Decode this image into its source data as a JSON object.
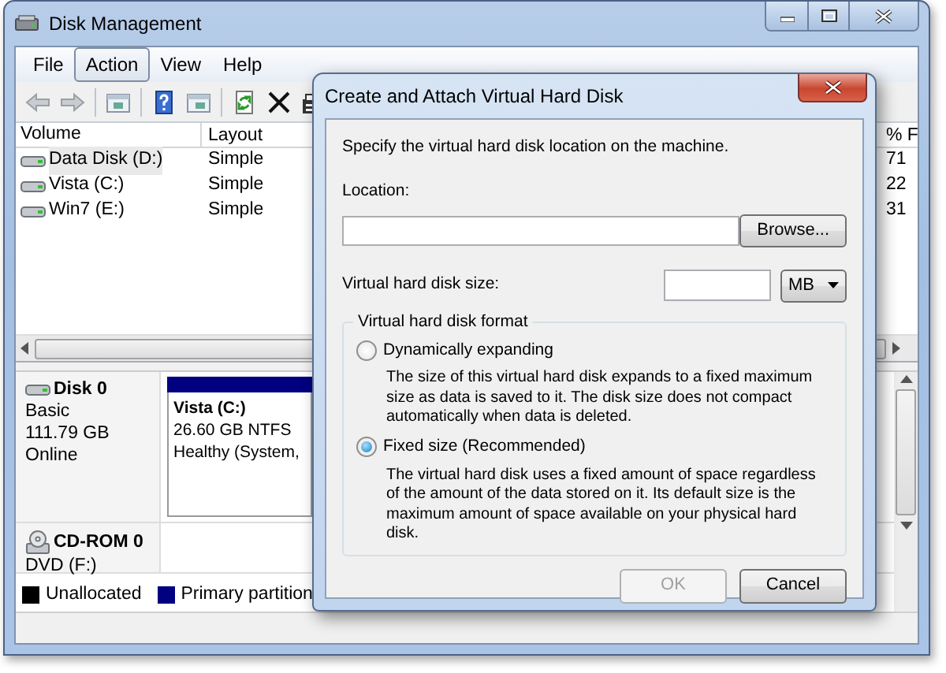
{
  "window": {
    "title": "Disk Management"
  },
  "menu": [
    {
      "label": "File",
      "selected": false
    },
    {
      "label": "Action",
      "selected": true
    },
    {
      "label": "View",
      "selected": false
    },
    {
      "label": "Help",
      "selected": false
    }
  ],
  "volumes": {
    "columns": [
      "Volume",
      "Layout",
      "% F"
    ],
    "rows": [
      {
        "volume": "Data Disk (D:)",
        "layout": "Simple",
        "column_3": "71",
        "selected": true
      },
      {
        "volume": "Vista (C:)",
        "layout": "Simple",
        "column_3": "22",
        "selected": false
      },
      {
        "volume": "Win7 (E:)",
        "layout": "Simple",
        "column_3": "31",
        "selected": false
      }
    ]
  },
  "disks": [
    {
      "kind": "disk",
      "name": "Disk 0",
      "details": [
        "Basic",
        "111.79 GB",
        "Online"
      ],
      "partitions": [
        {
          "name": "Vista  (C:)",
          "size": "26.60 GB NTFS",
          "status": "Healthy (System,"
        }
      ]
    },
    {
      "kind": "cdrom",
      "name": "CD-ROM 0",
      "details": [
        "DVD (F:)"
      ]
    }
  ],
  "legend": [
    {
      "label": "Unallocated",
      "color": "#000000"
    },
    {
      "label": "Primary partition",
      "color": "#000080"
    }
  ],
  "dialog": {
    "title": "Create and Attach Virtual Hard Disk",
    "instruction": "Specify the virtual hard disk location on the machine.",
    "location_label": "Location:",
    "browse_button": "Browse...",
    "size_label": "Virtual hard disk size:",
    "size_unit": "MB",
    "format_label": "Virtual hard disk format",
    "options": [
      {
        "label": "Dynamically expanding",
        "description": "The size of this virtual hard disk expands to a fixed maximum size as data is saved to it.  The disk size does not compact automatically when data is deleted.",
        "selected": false
      },
      {
        "label": "Fixed size (Recommended)",
        "description": "The virtual hard disk uses a fixed amount of space regardless of the amount of the data stored on it.  Its default size is the maximum amount of space available on your physical hard disk.",
        "selected": true
      }
    ],
    "buttons": [
      {
        "label": "OK",
        "disabled": true
      },
      {
        "label": "Cancel",
        "disabled": false
      }
    ]
  }
}
